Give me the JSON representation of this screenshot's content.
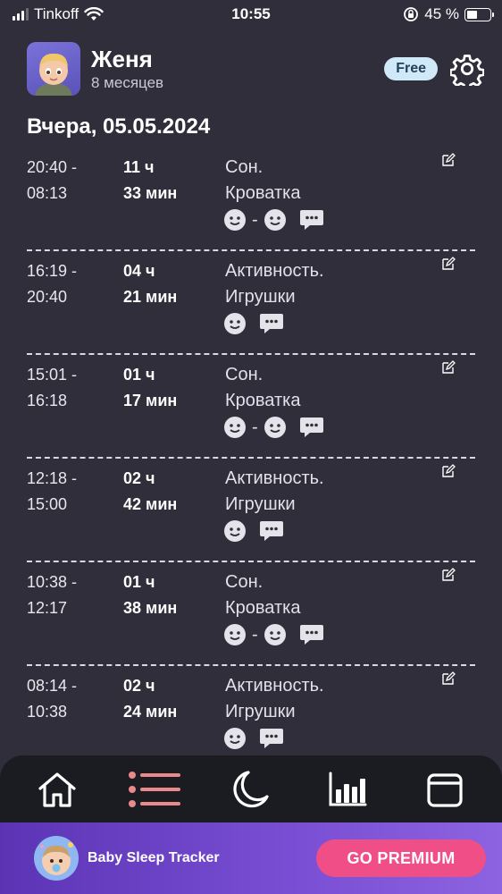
{
  "status_bar": {
    "carrier": "Tinkoff",
    "time": "10:55",
    "battery": "45 %",
    "battery_level": 0.45
  },
  "profile": {
    "name": "Женя",
    "age": "8 месяцев",
    "plan_badge": "Free"
  },
  "date_title": "Вчера, 05.05.2024",
  "entries": [
    {
      "start": "20:40 -",
      "end": "08:13",
      "hours": "11 ч",
      "minutes": "33 мин",
      "type": "Сон.",
      "place": "Кроватка",
      "mood": "range"
    },
    {
      "start": "16:19 -",
      "end": "20:40",
      "hours": "04 ч",
      "minutes": "21 мин",
      "type": "Активность.",
      "place": "Игрушки",
      "mood": "single"
    },
    {
      "start": "15:01 -",
      "end": "16:18",
      "hours": "01 ч",
      "minutes": "17 мин",
      "type": "Сон.",
      "place": "Кроватка",
      "mood": "range"
    },
    {
      "start": "12:18 -",
      "end": "15:00",
      "hours": "02 ч",
      "minutes": "42 мин",
      "type": "Активность.",
      "place": "Игрушки",
      "mood": "single"
    },
    {
      "start": "10:38 -",
      "end": "12:17",
      "hours": "01 ч",
      "minutes": "38 мин",
      "type": "Сон.",
      "place": "Кроватка",
      "mood": "range"
    },
    {
      "start": "08:14 -",
      "end": "10:38",
      "hours": "02 ч",
      "minutes": "24 мин",
      "type": "Активность.",
      "place": "Игрушки",
      "mood": "single"
    }
  ],
  "tabbar": {
    "items": [
      {
        "icon": "home-icon",
        "active": false
      },
      {
        "icon": "list-icon",
        "active": true
      },
      {
        "icon": "moon-icon",
        "active": false
      },
      {
        "icon": "chart-icon",
        "active": false
      },
      {
        "icon": "calendar-icon",
        "active": false
      }
    ]
  },
  "promo": {
    "title": "Baby Sleep Tracker",
    "button": "GO PREMIUM"
  },
  "colors": {
    "background": "#2f2e3a",
    "tabbar": "#1b1b22",
    "accent": "#ef4f86",
    "active_tab": "#e98a8a",
    "promo": "#7a4fd4"
  }
}
